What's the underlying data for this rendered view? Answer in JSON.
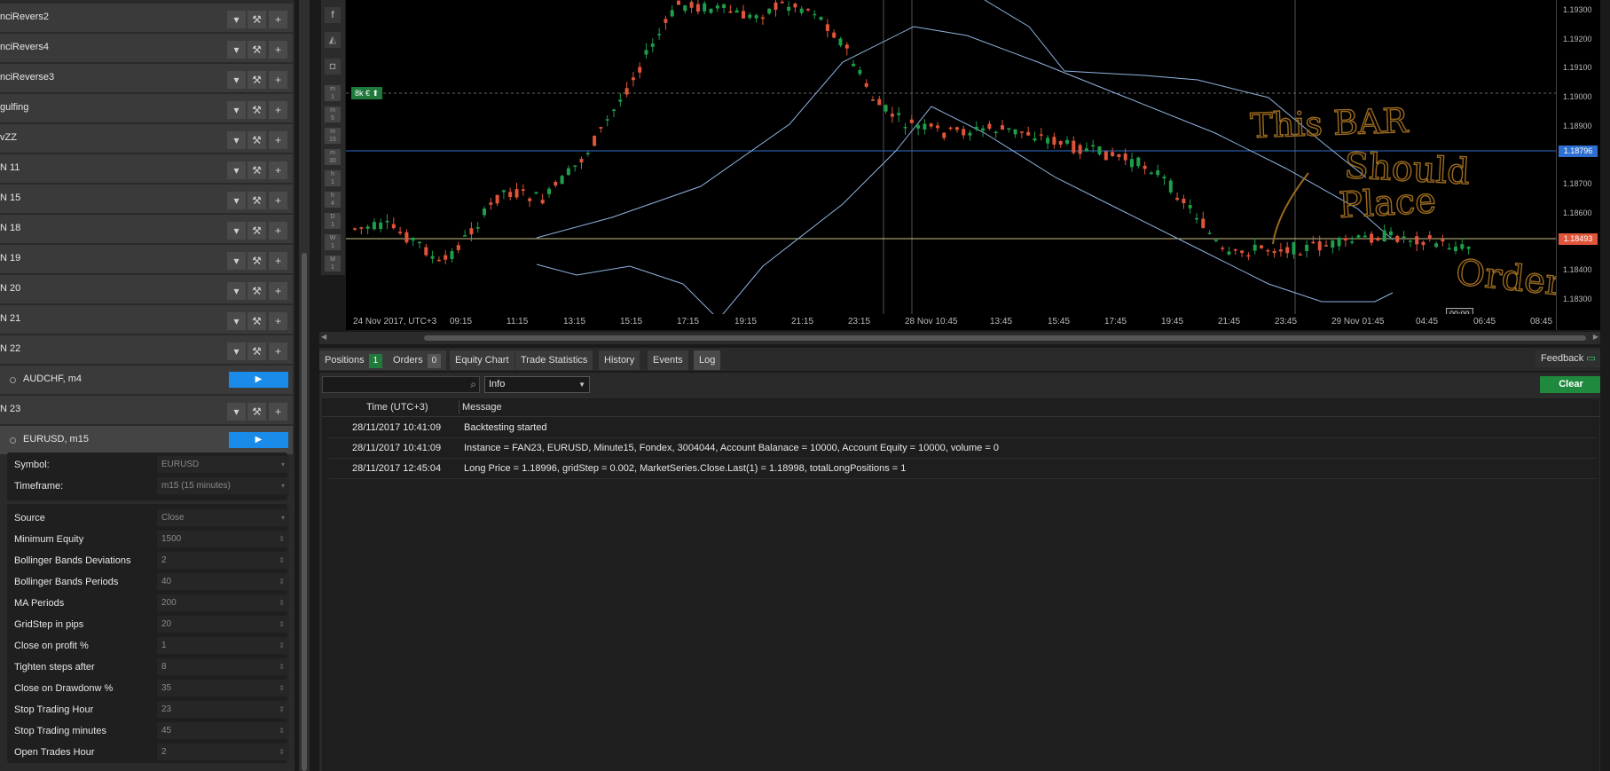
{
  "bots": [
    {
      "name": "nciRevers2"
    },
    {
      "name": "nciRevers4"
    },
    {
      "name": "nciReverse3"
    },
    {
      "name": "gulfing"
    },
    {
      "name": "vZZ"
    },
    {
      "name": "N 11"
    },
    {
      "name": "N 15"
    },
    {
      "name": "N 18"
    },
    {
      "name": "N 19"
    },
    {
      "name": "N 20"
    },
    {
      "name": "N 21"
    },
    {
      "name": "N 22"
    }
  ],
  "instance_audchf": {
    "label": "AUDCHF, m4"
  },
  "bot_n23": {
    "name": "N 23"
  },
  "instance_eurusd": {
    "label": "EURUSD, m15"
  },
  "symbol": {
    "label": "Symbol:",
    "value": "EURUSD"
  },
  "timeframe": {
    "label": "Timeframe:",
    "value": "m15 (15 minutes)"
  },
  "parameters": [
    {
      "label": "Source",
      "value": "Close"
    },
    {
      "label": "Minimum Equity",
      "value": "1500"
    },
    {
      "label": "Bollinger Bands Deviations",
      "value": "2"
    },
    {
      "label": "Bollinger Bands Periods",
      "value": "40"
    },
    {
      "label": "MA Periods",
      "value": "200"
    },
    {
      "label": "GridStep in pips",
      "value": "20"
    },
    {
      "label": "Close on profit %",
      "value": "1"
    },
    {
      "label": "Tighten steps after",
      "value": "8"
    },
    {
      "label": "Close on Drawdonw %",
      "value": "35"
    },
    {
      "label": "Stop Trading Hour",
      "value": "23"
    },
    {
      "label": "Stop Trading minutes",
      "value": "45"
    },
    {
      "label": "Open Trades Hour",
      "value": "2"
    }
  ],
  "chart": {
    "position_label": "8k €",
    "current_price": "1.18493",
    "blue_line_price": "1.18796",
    "price_labels": [
      "1.19300",
      "1.19200",
      "1.19100",
      "1.19000",
      "1.18900",
      "1.18700",
      "1.18600",
      "1.18400",
      "1.18300"
    ],
    "time_labels": [
      "24 Nov 2017, UTC+3",
      "09:15",
      "11:15",
      "13:15",
      "15:15",
      "17:15",
      "19:15",
      "21:15",
      "23:15",
      "28 Nov 10:45",
      "13:45",
      "15:45",
      "17:45",
      "19:45",
      "21:45",
      "23:45",
      "29 Nov 01:45",
      "04:45",
      "06:45",
      "08:45"
    ],
    "countdown": "00:00",
    "annotation": "This BAR Should Place Order",
    "colors": {
      "bull": "#1e9e4a",
      "bear": "#e0553a",
      "band": "#8fb4e0",
      "annotation": "#9a6a1f",
      "current_line": "#c9c28a",
      "blue_line": "#2f6fd1"
    }
  },
  "tabs": [
    {
      "label": "Positions",
      "count": "1"
    },
    {
      "label": "Orders",
      "count": "0"
    },
    {
      "label": "Equity Chart"
    },
    {
      "label": "Trade Statistics"
    },
    {
      "label": "History"
    },
    {
      "label": "Events"
    },
    {
      "label": "Log"
    }
  ],
  "feedback": {
    "label": "Feedback"
  },
  "log": {
    "filter_value": "Info",
    "clear_label": "Clear",
    "col_time": "Time (UTC+3)",
    "col_message": "Message",
    "rows": [
      {
        "time": "28/11/2017 10:41:09",
        "message": "Backtesting started"
      },
      {
        "time": "28/11/2017 10:41:09",
        "message": "Instance = FAN23, EURUSD, Minute15, Fondex, 3004044, Account Balanace = 10000, Account Equity = 10000, volume = 0"
      },
      {
        "time": "28/11/2017 12:45:04",
        "message": "Long Price = 1.18996, gridStep = 0.002, MarketSeries.Close.Last(1) = 1.18998, totalLongPositions = 1"
      }
    ]
  }
}
